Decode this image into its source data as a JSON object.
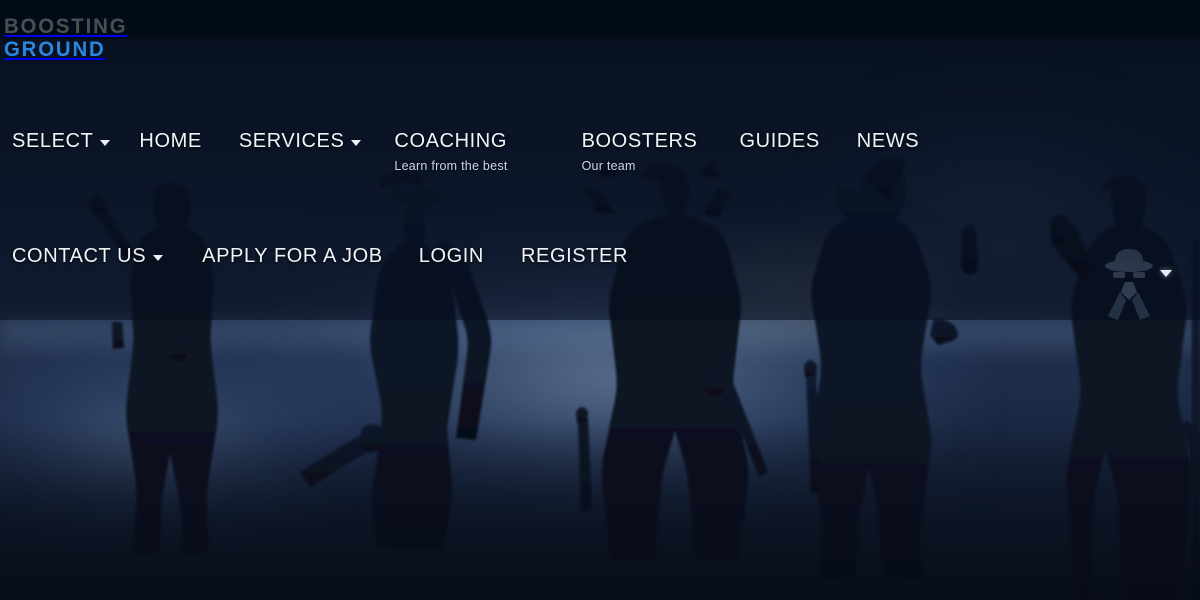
{
  "site": {
    "logo": {
      "line1": "BOOSTING",
      "line2": "GROUND",
      "line1_color": "#4c4f52",
      "line2_color": "#2b86e0"
    }
  },
  "nav": {
    "row1": [
      {
        "label": "SELECT",
        "caret": true,
        "sub": ""
      },
      {
        "label": "HOME",
        "caret": false,
        "sub": ""
      },
      {
        "label": "SERVICES",
        "caret": true,
        "sub": ""
      },
      {
        "label": "COACHING",
        "caret": false,
        "sub": "Learn from the best"
      },
      {
        "label": "BOOSTERS",
        "caret": false,
        "sub": "Our team"
      },
      {
        "label": "GUIDES",
        "caret": false,
        "sub": ""
      },
      {
        "label": "NEWS",
        "caret": false,
        "sub": ""
      }
    ],
    "row2": [
      {
        "label": "CONTACT US",
        "caret": true,
        "sub": ""
      },
      {
        "label": "APPLY FOR A JOB",
        "caret": false,
        "sub": ""
      },
      {
        "label": "LOGIN",
        "caret": false,
        "sub": ""
      },
      {
        "label": "REGISTER",
        "caret": false,
        "sub": ""
      }
    ]
  },
  "hero": {
    "background_description": "Valorant agent silhouettes against a dark blue misty night sky",
    "figure_count": 6,
    "overlay_color": "#060d1a",
    "topbar_color": "#020b18"
  },
  "widgets": {
    "corner_dropdown_caret": "▼"
  }
}
